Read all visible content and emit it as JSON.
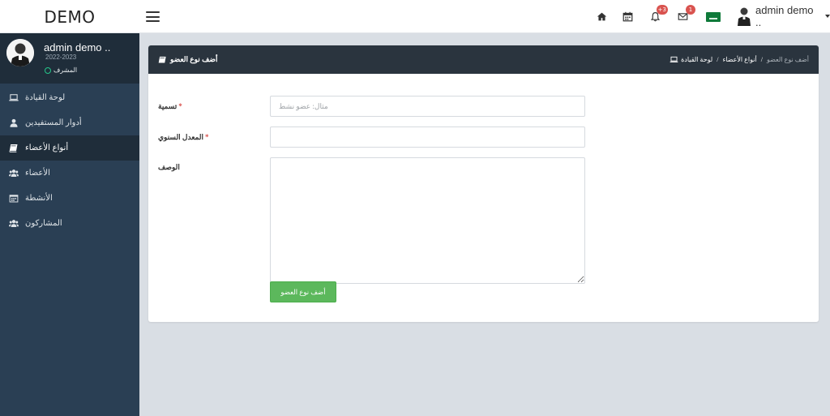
{
  "app": {
    "brand": "DEMO"
  },
  "topbar": {
    "notifications_badge": "+3",
    "messages_badge": "1",
    "flag_text": "ﺲ",
    "user_name": "admin demo .."
  },
  "sidebar": {
    "profile": {
      "name": "admin demo ..",
      "year": "2022-2023",
      "role": "المشرف"
    },
    "items": [
      {
        "label": "لوحة القيادة",
        "icon": "laptop-icon",
        "active": false
      },
      {
        "label": "أدوار المستفيدين",
        "icon": "user-icon",
        "active": false
      },
      {
        "label": "أنواع الأعضاء",
        "icon": "book-icon",
        "active": true
      },
      {
        "label": "الأعضاء",
        "icon": "users-icon",
        "active": false
      },
      {
        "label": "الأنشطة",
        "icon": "calendar-icon",
        "active": false
      },
      {
        "label": "المشاركون",
        "icon": "users-icon",
        "active": false
      }
    ]
  },
  "panel": {
    "title": "أضف نوع العضو",
    "breadcrumb": {
      "home": "لوحة القيادة",
      "section": "أنواع الأعضاء",
      "current": "أضف نوع العضو"
    }
  },
  "form": {
    "name_label": "تسمية",
    "name_placeholder": "مثال: عضو نشط",
    "name_value": "",
    "rate_label": "المعدل السنوي",
    "rate_value": "",
    "description_label": "الوصف",
    "description_value": "",
    "required_mark": "*",
    "submit_label": "أضف نوع العضو"
  },
  "colors": {
    "sidebar_bg": "#2a3f54",
    "panel_header_bg": "#2a343e",
    "submit_bg": "#5cb85c",
    "badge_bg": "#d9534f",
    "flag_bg": "#0f7a3a"
  }
}
